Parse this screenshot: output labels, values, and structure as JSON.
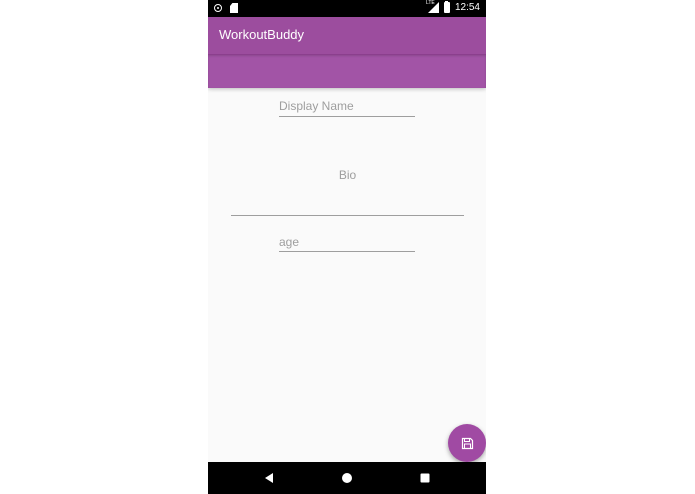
{
  "status_bar": {
    "time": "12:54",
    "network": "LTE"
  },
  "app_bar": {
    "title": "WorkoutBuddy"
  },
  "form": {
    "display_name_placeholder": "Display Name",
    "bio_placeholder": "Bio",
    "age_placeholder": "age"
  },
  "fab": {
    "icon": "save-icon",
    "color": "#a04aa3"
  },
  "nav_bar": {
    "icons": [
      "back-icon",
      "home-icon",
      "recent-apps-icon"
    ]
  },
  "colors": {
    "primary": "#9c4d9e",
    "background": "#fafafa",
    "hint_text": "#9e9e9e"
  }
}
